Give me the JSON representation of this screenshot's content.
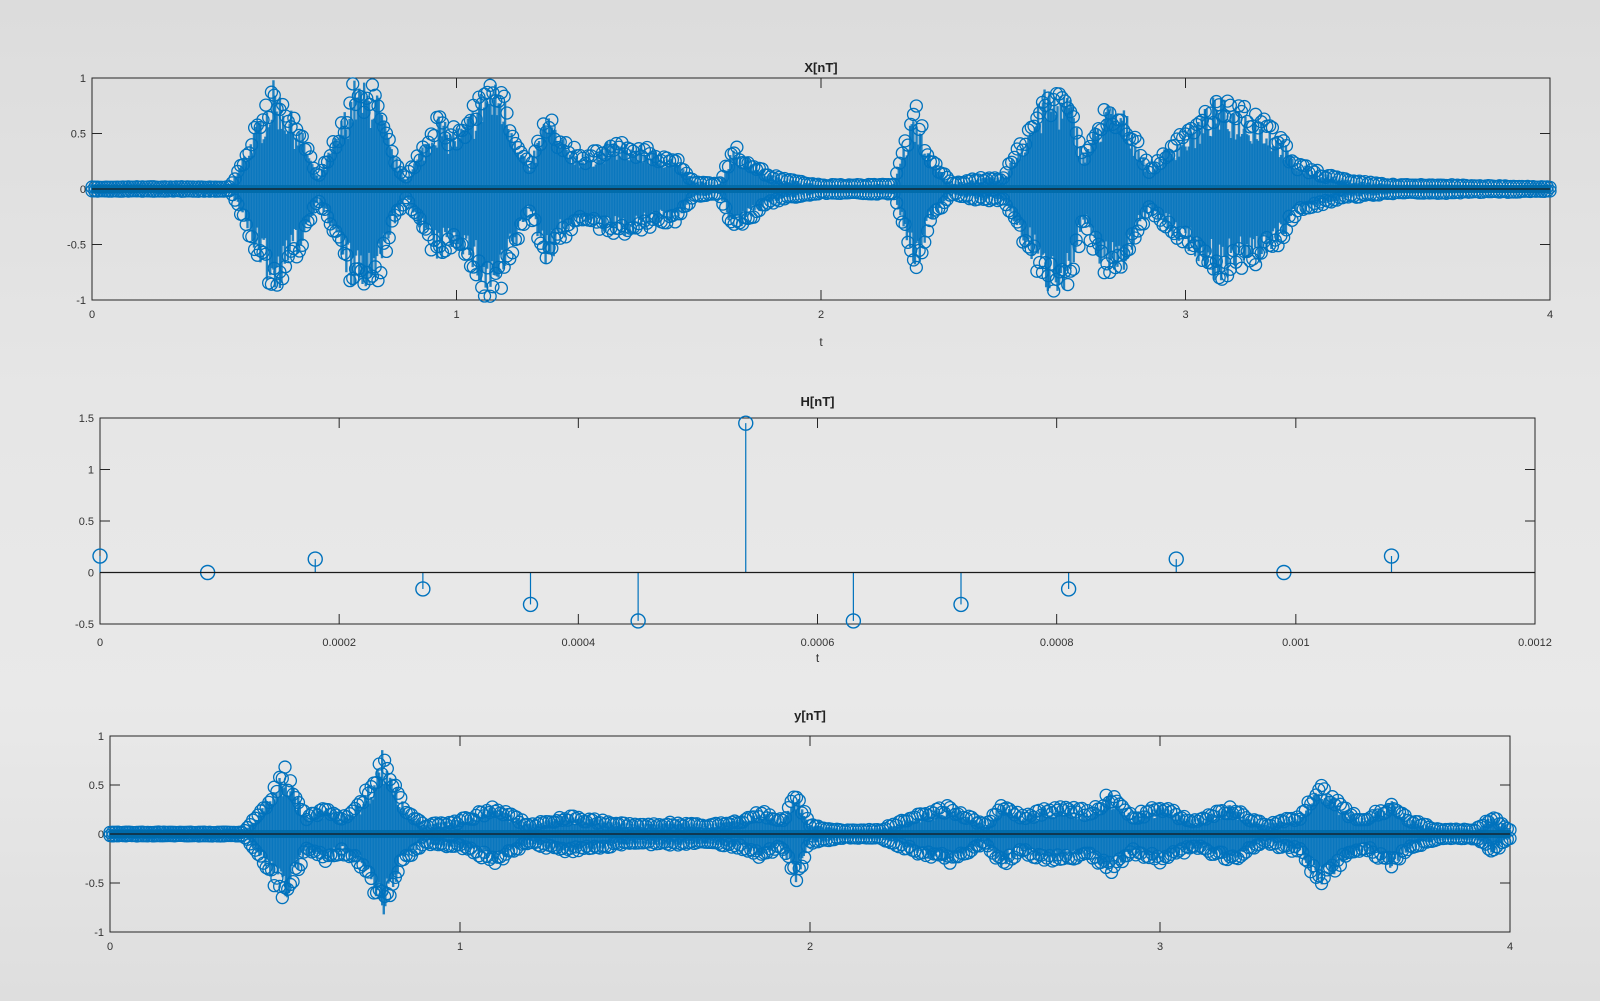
{
  "palette": {
    "series": "#0072bd",
    "axis": "#262626",
    "zero": "#1a1a1a",
    "background": "#e4e4e4"
  },
  "chart_data": [
    {
      "id": "x",
      "type": "scatter",
      "marker": "circle-stem",
      "title": "X[nT]",
      "xlabel": "t",
      "ylabel": "",
      "xlim": [
        0,
        4
      ],
      "ylim": [
        -1,
        1
      ],
      "xticks": [
        0,
        1,
        2,
        3,
        4
      ],
      "yticks": [
        -1,
        -0.5,
        0,
        0.5,
        1
      ],
      "xtick_labels": [
        "0",
        "1",
        "2",
        "3",
        "4"
      ],
      "ytick_labels": [
        "-1",
        "-0.5",
        "0",
        "0.5",
        "1"
      ],
      "grid": false,
      "envelope": {
        "t": [
          0,
          0.38,
          0.42,
          0.5,
          0.58,
          0.62,
          0.68,
          0.72,
          0.78,
          0.82,
          0.86,
          0.95,
          0.98,
          1.02,
          1.08,
          1.12,
          1.2,
          1.25,
          1.28,
          1.35,
          1.42,
          1.5,
          1.6,
          1.65,
          1.72,
          1.76,
          1.8,
          1.85,
          1.9,
          1.96,
          2.0,
          2.1,
          2.2,
          2.26,
          2.3,
          2.36,
          2.42,
          2.5,
          2.62,
          2.68,
          2.72,
          2.78,
          2.83,
          2.9,
          2.95,
          3.02,
          3.08,
          3.12,
          3.2,
          3.26,
          3.3,
          3.38,
          3.45,
          3.52,
          3.58,
          3.65,
          3.72,
          3.8,
          3.88,
          4.0
        ],
        "upper": [
          0.02,
          0.02,
          0.35,
          1.0,
          0.5,
          0.1,
          0.6,
          1.0,
          0.95,
          0.4,
          0.1,
          0.7,
          0.55,
          0.6,
          1.0,
          0.95,
          0.2,
          0.75,
          0.5,
          0.3,
          0.45,
          0.4,
          0.3,
          0.08,
          0.05,
          0.4,
          0.3,
          0.15,
          0.1,
          0.06,
          0.04,
          0.04,
          0.05,
          0.8,
          0.3,
          0.05,
          0.1,
          0.12,
          0.95,
          0.9,
          0.35,
          0.8,
          0.75,
          0.2,
          0.4,
          0.6,
          0.85,
          0.8,
          0.7,
          0.5,
          0.25,
          0.15,
          0.08,
          0.06,
          0.04,
          0.04,
          0.04,
          0.03,
          0.03,
          0.02
        ],
        "lower": [
          -0.02,
          -0.02,
          -0.35,
          -1.0,
          -0.5,
          -0.1,
          -0.6,
          -1.0,
          -0.95,
          -0.4,
          -0.1,
          -0.7,
          -0.55,
          -0.6,
          -1.0,
          -0.95,
          -0.2,
          -0.75,
          -0.5,
          -0.3,
          -0.45,
          -0.4,
          -0.3,
          -0.08,
          -0.05,
          -0.4,
          -0.3,
          -0.15,
          -0.1,
          -0.06,
          -0.04,
          -0.04,
          -0.05,
          -0.8,
          -0.3,
          -0.05,
          -0.1,
          -0.12,
          -0.95,
          -0.9,
          -0.35,
          -0.8,
          -0.75,
          -0.2,
          -0.4,
          -0.6,
          -0.85,
          -0.8,
          -0.7,
          -0.5,
          -0.25,
          -0.15,
          -0.08,
          -0.06,
          -0.04,
          -0.04,
          -0.04,
          -0.03,
          -0.03,
          -0.02
        ]
      }
    },
    {
      "id": "h",
      "type": "scatter",
      "marker": "circle-stem",
      "title": "H[nT]",
      "xlabel": "t",
      "ylabel": "",
      "xlim": [
        0,
        0.0012
      ],
      "ylim": [
        -0.5,
        1.5
      ],
      "xticks": [
        0,
        0.0002,
        0.0004,
        0.0006,
        0.0008,
        0.001,
        0.0012
      ],
      "yticks": [
        -0.5,
        0,
        0.5,
        1,
        1.5
      ],
      "xtick_labels": [
        "0",
        "0.0002",
        "0.0004",
        "0.0006",
        "0.0008",
        "0.001",
        "0.0012"
      ],
      "ytick_labels": [
        "-0.5",
        "0",
        "0.5",
        "1",
        "1.5"
      ],
      "grid": false,
      "x": [
        0,
        9e-05,
        0.00018,
        0.00027,
        0.00036,
        0.00045,
        0.00054,
        0.00063,
        0.00072,
        0.00081,
        0.0009,
        0.00099,
        0.00108
      ],
      "y": [
        0.16,
        0.0,
        0.13,
        -0.16,
        -0.31,
        -0.47,
        1.45,
        -0.47,
        -0.31,
        -0.16,
        0.13,
        0.0,
        0.16
      ]
    },
    {
      "id": "y",
      "type": "scatter",
      "marker": "circle-stem",
      "title": "y[nT]",
      "xlabel": "",
      "ylabel": "",
      "xlim": [
        0,
        4
      ],
      "ylim": [
        -1,
        1
      ],
      "xticks": [
        0,
        1,
        2,
        3,
        4
      ],
      "yticks": [
        -1,
        -0.5,
        0,
        0.5,
        1
      ],
      "xtick_labels": [
        "0",
        "1",
        "2",
        "3",
        "4"
      ],
      "ytick_labels": [
        "-1",
        "-0.5",
        "0",
        "0.5",
        "1"
      ],
      "grid": false,
      "envelope": {
        "t": [
          0,
          0.38,
          0.42,
          0.5,
          0.56,
          0.62,
          0.66,
          0.72,
          0.78,
          0.84,
          0.9,
          1.0,
          1.1,
          1.2,
          1.3,
          1.4,
          1.5,
          1.6,
          1.7,
          1.8,
          1.86,
          1.92,
          1.96,
          2.0,
          2.1,
          2.2,
          2.3,
          2.4,
          2.5,
          2.55,
          2.6,
          2.7,
          2.8,
          2.86,
          2.92,
          3.0,
          3.1,
          3.2,
          3.3,
          3.4,
          3.46,
          3.52,
          3.58,
          3.66,
          3.72,
          3.8,
          3.9,
          3.95,
          4.0
        ],
        "upper": [
          0.02,
          0.02,
          0.2,
          0.7,
          0.2,
          0.3,
          0.2,
          0.35,
          0.9,
          0.3,
          0.1,
          0.15,
          0.3,
          0.1,
          0.2,
          0.15,
          0.1,
          0.12,
          0.1,
          0.15,
          0.25,
          0.15,
          0.45,
          0.1,
          0.04,
          0.05,
          0.2,
          0.3,
          0.1,
          0.35,
          0.2,
          0.3,
          0.25,
          0.45,
          0.2,
          0.3,
          0.15,
          0.3,
          0.1,
          0.2,
          0.55,
          0.3,
          0.15,
          0.35,
          0.15,
          0.05,
          0.05,
          0.2,
          0.05
        ],
        "lower": [
          -0.02,
          -0.02,
          -0.2,
          -0.75,
          -0.2,
          -0.3,
          -0.2,
          -0.35,
          -0.85,
          -0.3,
          -0.1,
          -0.15,
          -0.3,
          -0.1,
          -0.2,
          -0.15,
          -0.1,
          -0.12,
          -0.1,
          -0.15,
          -0.25,
          -0.15,
          -0.5,
          -0.1,
          -0.04,
          -0.05,
          -0.2,
          -0.3,
          -0.1,
          -0.35,
          -0.2,
          -0.3,
          -0.25,
          -0.4,
          -0.2,
          -0.3,
          -0.15,
          -0.3,
          -0.1,
          -0.2,
          -0.6,
          -0.3,
          -0.15,
          -0.35,
          -0.15,
          -0.05,
          -0.05,
          -0.2,
          -0.05
        ]
      }
    }
  ]
}
